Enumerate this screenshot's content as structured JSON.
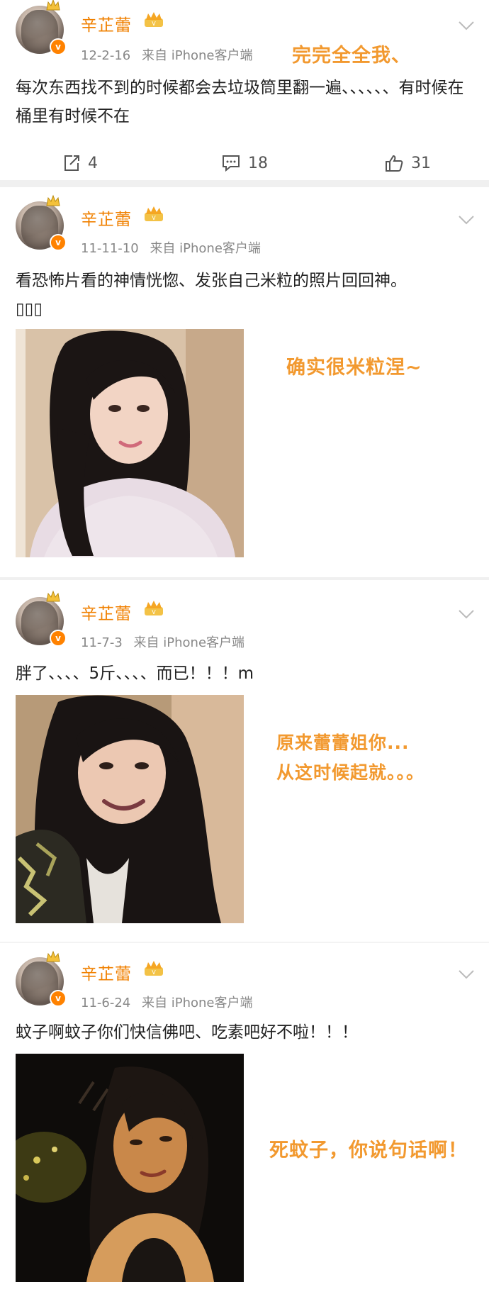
{
  "posts": [
    {
      "author": "辛芷蕾",
      "date": "12-2-16",
      "source": "来自 iPhone客户端",
      "text": "每次东西找不到的时候都会去垃圾筒里翻一遍、、、、、、有时候在桶里有时候不在",
      "annotation": "完完全全我、",
      "actions": {
        "repost": "4",
        "comment": "18",
        "like": "31"
      }
    },
    {
      "author": "辛芷蕾",
      "date": "11-11-10",
      "source": "来自 iPhone客户端",
      "text": "看恐怖片看的神情恍惚、发张自己米粒的照片回回神。",
      "emoji_placeholder": "▯▯▯",
      "annotation": "确实很米粒涅~",
      "image_icon": "photo-portrait-white-fluffy-top"
    },
    {
      "author": "辛芷蕾",
      "date": "11-7-3",
      "source": "来自 iPhone客户端",
      "text": "胖了、、、、5斤、、、、而已！！！m",
      "annotation_line1": "原来蕾蕾姐你...",
      "annotation_line2": "从这时候起就。。。",
      "image_icon": "photo-portrait-smiling-dark-hair"
    },
    {
      "author": "辛芷蕾",
      "date": "11-6-24",
      "source": "来自 iPhone客户端",
      "text": "蚊子啊蚊子你们快信佛吧、吃素吧好不啦！！！",
      "annotation": "死蚊子，你说句话啊！",
      "image_icon": "photo-night-portrait"
    }
  ],
  "colors": {
    "name": "#f08000",
    "annotation": "#f2992f",
    "meta": "#888888",
    "badge": "#ff8200"
  }
}
